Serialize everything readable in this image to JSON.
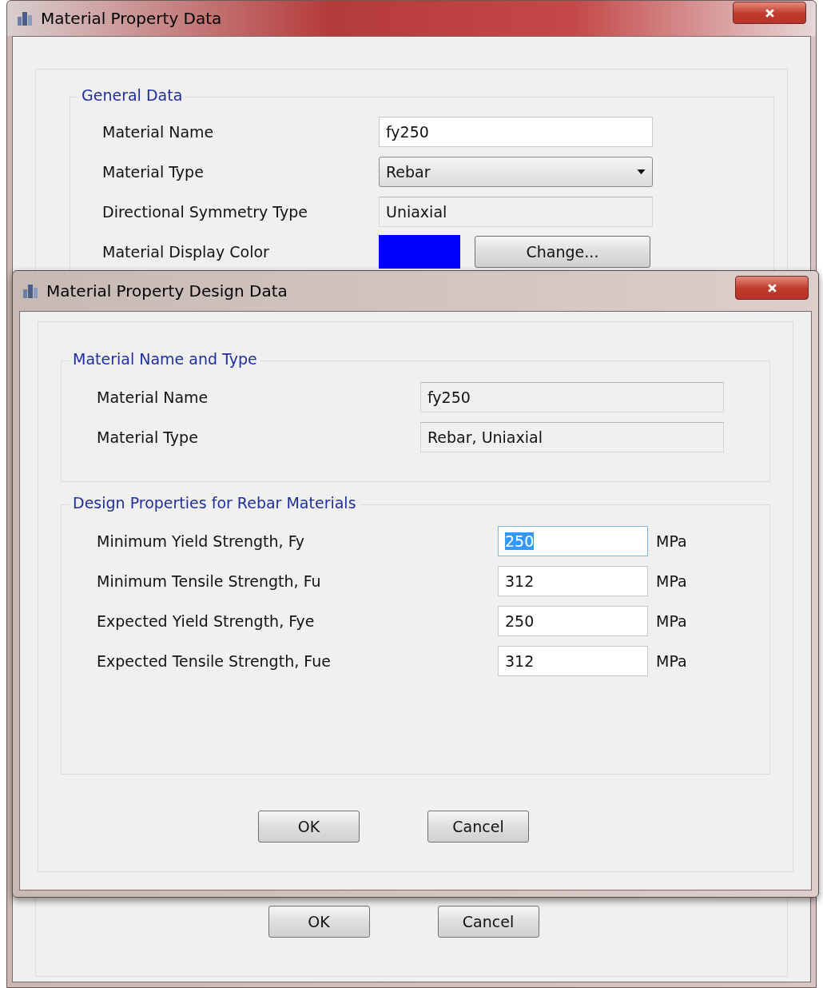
{
  "back_window": {
    "title": "Material Property Data",
    "general_data": {
      "title": "General Data",
      "rows": [
        {
          "kind": "text",
          "label": "Material Name",
          "value": "fy250"
        },
        {
          "kind": "dropdown",
          "label": "Material Type",
          "value": "Rebar"
        },
        {
          "kind": "readonly",
          "label": "Directional Symmetry Type",
          "value": "Uniaxial"
        },
        {
          "kind": "color",
          "label": "Material Display Color",
          "color": "#0000ff",
          "button": "Change..."
        }
      ]
    },
    "buttons": [
      "OK",
      "Cancel"
    ]
  },
  "dialog": {
    "title": "Material Property Design Data",
    "name_type": {
      "title": "Material Name and Type",
      "rows": [
        {
          "label": "Material Name",
          "value": "fy250"
        },
        {
          "label": "Material Type",
          "value": "Rebar, Uniaxial"
        }
      ]
    },
    "design": {
      "title": "Design Properties for Rebar Materials",
      "rows": [
        {
          "label": "Minimum Yield Strength, Fy",
          "value": "250",
          "unit": "MPa",
          "text_selected": true
        },
        {
          "label": "Minimum Tensile Strength, Fu",
          "value": "312",
          "unit": "MPa",
          "text_selected": false
        },
        {
          "label": "Expected Yield Strength, Fye",
          "value": "250",
          "unit": "MPa",
          "text_selected": false
        },
        {
          "label": "Expected Tensile Strength, Fue",
          "value": "312",
          "unit": "MPa",
          "text_selected": false
        }
      ]
    },
    "buttons": [
      "OK",
      "Cancel"
    ]
  }
}
